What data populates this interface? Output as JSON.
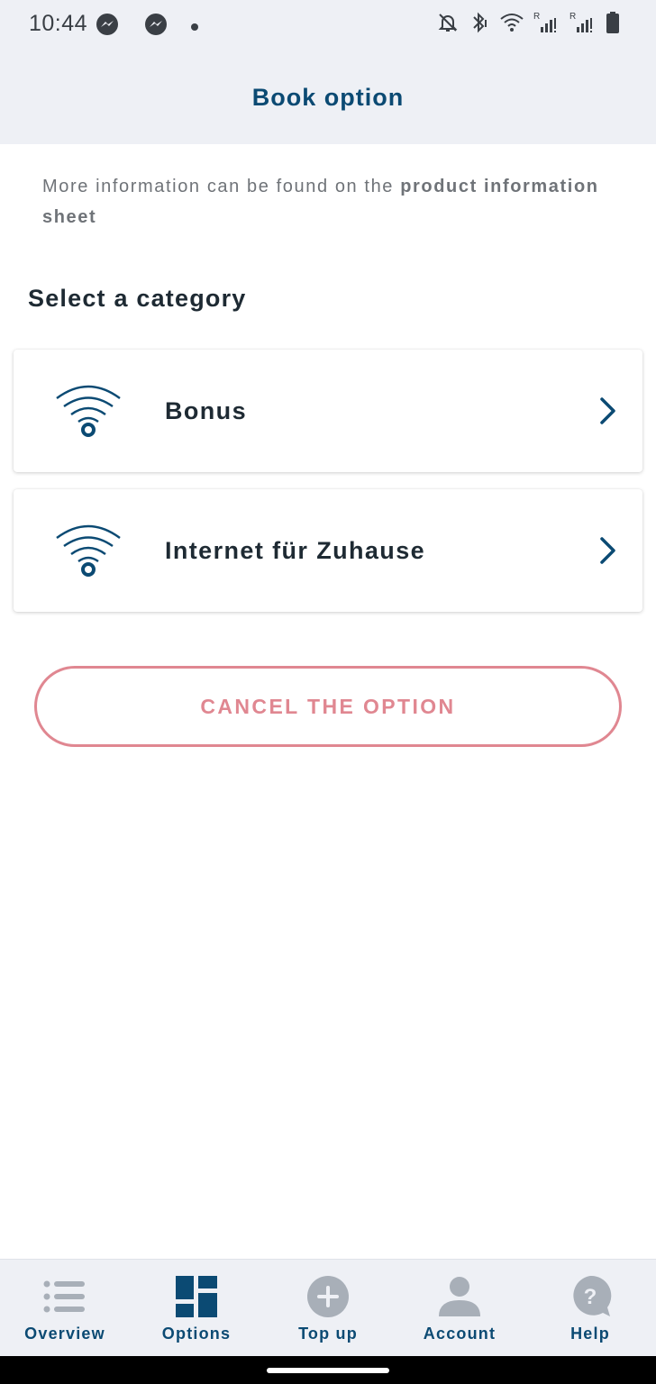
{
  "status_bar": {
    "time": "10:44",
    "left_icons": [
      "messenger-icon",
      "messenger-icon",
      "notification-dot"
    ],
    "right_icons": [
      "notifications-off-icon",
      "bluetooth-icon",
      "wifi-icon",
      "signal-r-icon",
      "signal-r-icon",
      "battery-icon"
    ]
  },
  "header": {
    "title": "Book option"
  },
  "info": {
    "prefix": "More information can be found on the ",
    "link": "product information sheet"
  },
  "section": {
    "title": "Select a category"
  },
  "categories": [
    {
      "label": "Bonus",
      "icon": "wifi-icon"
    },
    {
      "label": "Internet für Zuhause",
      "icon": "wifi-icon"
    }
  ],
  "cancel_button": {
    "label": "CANCEL THE OPTION"
  },
  "bottom_nav": {
    "items": [
      {
        "label": "Overview",
        "icon": "list-icon",
        "active": false
      },
      {
        "label": "Options",
        "icon": "dashboard-icon",
        "active": true
      },
      {
        "label": "Top up",
        "icon": "plus-circle-icon",
        "active": false
      },
      {
        "label": "Account",
        "icon": "person-icon",
        "active": false
      },
      {
        "label": "Help",
        "icon": "help-bubble-icon",
        "active": false
      }
    ]
  },
  "colors": {
    "brand_blue": "#0b4a73",
    "header_bg": "#eef0f5",
    "cancel_pink": "#e08791",
    "inactive_icon": "#a8afb8"
  }
}
